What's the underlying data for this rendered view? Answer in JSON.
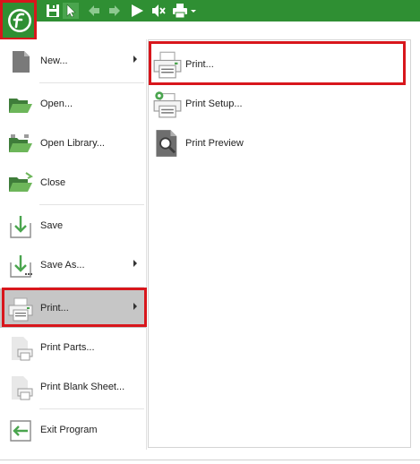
{
  "toolbar": {
    "icons": [
      "app-logo-icon",
      "save-icon",
      "select-cursor-icon",
      "back-arrow-icon",
      "forward-arrow-icon",
      "play-icon",
      "mute-icon",
      "print-icon",
      "dropdown-caret-icon"
    ],
    "accent_color": "#2f8f33",
    "highlight_color": "#d8161c"
  },
  "menu": {
    "items": [
      {
        "label": "New...",
        "icon": "new-document-icon",
        "submenu": true
      },
      {
        "label": "Open...",
        "icon": "open-folder-icon",
        "submenu": false
      },
      {
        "label": "Open Library...",
        "icon": "open-library-folder-icon",
        "submenu": false
      },
      {
        "label": "Close",
        "icon": "close-folder-icon",
        "submenu": false
      },
      {
        "label": "Save",
        "icon": "save-arrow-icon",
        "submenu": false
      },
      {
        "label": "Save As...",
        "icon": "save-as-icon",
        "submenu": true
      },
      {
        "label": "Print...",
        "icon": "printer-icon",
        "submenu": true,
        "selected": true
      },
      {
        "label": "Print Parts...",
        "icon": "print-parts-icon",
        "submenu": false
      },
      {
        "label": "Print Blank Sheet...",
        "icon": "print-blank-sheet-icon",
        "submenu": false
      },
      {
        "label": "Exit Program",
        "icon": "exit-icon",
        "submenu": false
      }
    ]
  },
  "submenu": {
    "items": [
      {
        "label": "Print...",
        "icon": "printer-icon"
      },
      {
        "label": "Print Setup...",
        "icon": "print-setup-icon"
      },
      {
        "label": "Print Preview",
        "icon": "print-preview-icon"
      }
    ]
  }
}
